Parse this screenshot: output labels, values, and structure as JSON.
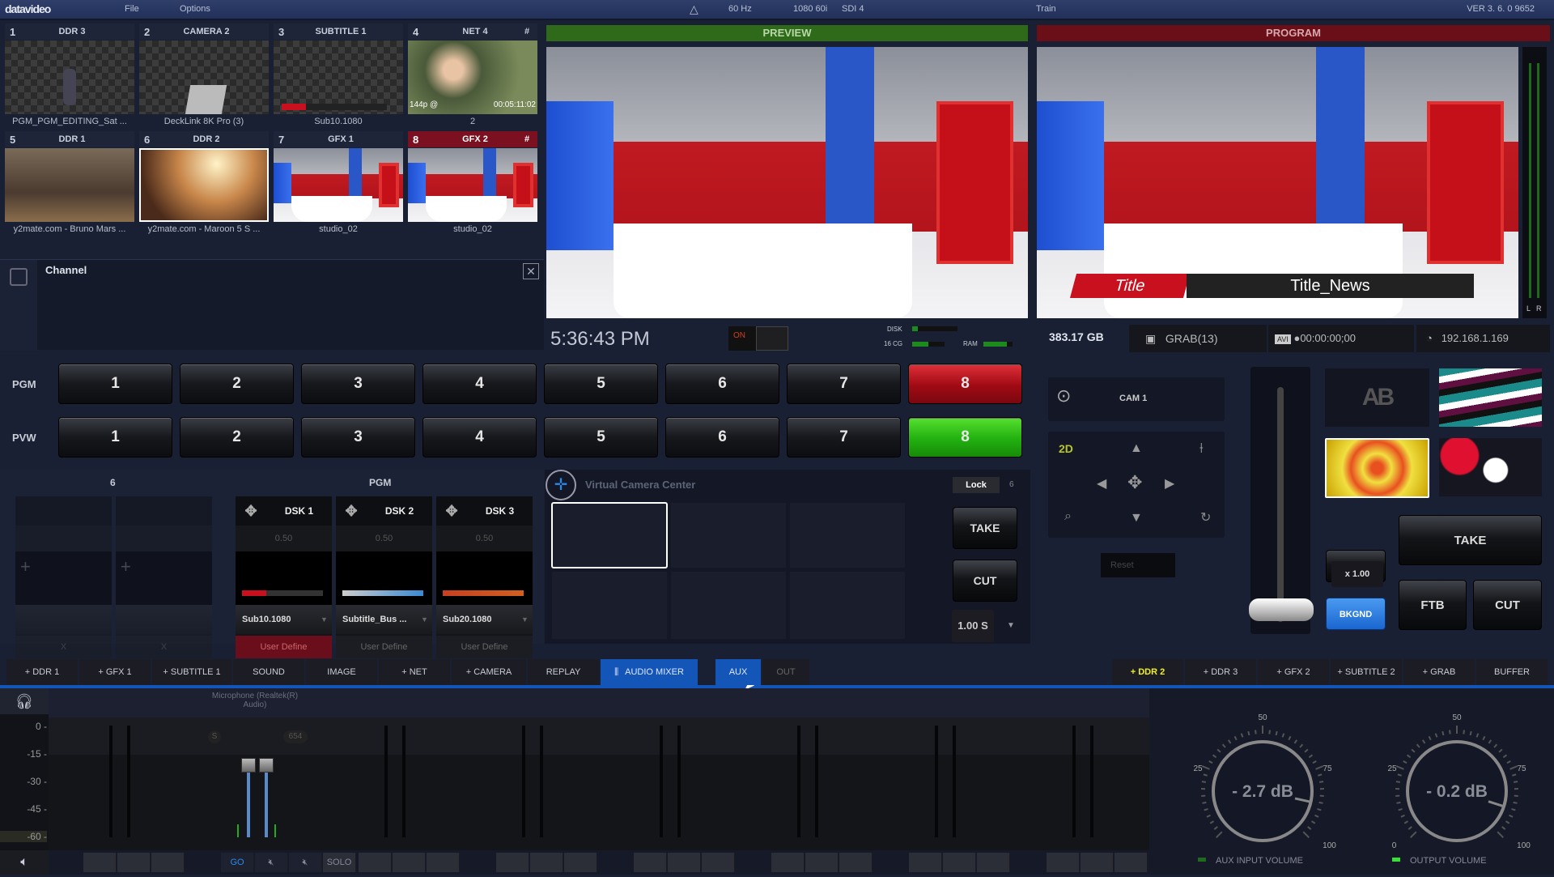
{
  "topbar": {
    "logo": "datavideo",
    "menu": [
      "File",
      "Options"
    ],
    "refresh_rate": "60 Hz",
    "format": "1080 60i",
    "output": "SDI 4",
    "user": "Train",
    "version": "VER 3. 6. 0 9652"
  },
  "sources": [
    {
      "num": "1",
      "name": "DDR 3",
      "label": "PGM_PGM_EDITING_Sat ...",
      "hash": "",
      "thumb": "checker-person"
    },
    {
      "num": "2",
      "name": "CAMERA 2",
      "label": "DeckLink 8K Pro (3)",
      "hash": "",
      "thumb": "checker-chair"
    },
    {
      "num": "3",
      "name": "SUBTITLE 1",
      "label": "Sub10.1080",
      "hash": "",
      "thumb": "checker-subtitle"
    },
    {
      "num": "4",
      "name": "NET 4",
      "label": "2",
      "hash": "#",
      "thumb": "face",
      "overlay_left": "144p @",
      "overlay_right": "00:05:11:02"
    },
    {
      "num": "5",
      "name": "DDR 1",
      "label": "y2mate.com - Bruno Mars ...",
      "hash": "",
      "thumb": "party"
    },
    {
      "num": "6",
      "name": "DDR 2",
      "label": "y2mate.com - Maroon 5  S ...",
      "hash": "",
      "thumb": "warm"
    },
    {
      "num": "7",
      "name": "GFX 1",
      "label": "studio_02",
      "hash": "",
      "thumb": "studio"
    },
    {
      "num": "8",
      "name": "GFX 2",
      "label": "studio_02",
      "hash": "#",
      "thumb": "studio",
      "active": true
    }
  ],
  "channel": {
    "title": "Channel"
  },
  "preview": {
    "label": "PREVIEW",
    "color": "#2f6a1a"
  },
  "program": {
    "label": "PROGRAM",
    "color": "#6a0e18",
    "lower_third_title": "Title",
    "lower_third_text": "Title_News",
    "meter_l": "L",
    "meter_r": "R"
  },
  "status": {
    "clock": "5:36:43 PM",
    "on_label": "ON",
    "disk_label": "DISK",
    "mem_label": "16 CG",
    "ram_label": "RAM",
    "free_space": "383.17 GB",
    "grab": "GRAB(13)",
    "rec_format": "AVI",
    "rec_time": "00:00:00;00",
    "ip": "192.168.1.169"
  },
  "bus": {
    "pgm_label": "PGM",
    "pvw_label": "PVW",
    "buttons": [
      "1",
      "2",
      "3",
      "4",
      "5",
      "6",
      "7",
      "8"
    ],
    "pgm_active": "8",
    "pvw_active": "8"
  },
  "keyers": {
    "group1_title": "6",
    "group2_title": "PGM",
    "blank_close": "X",
    "dsk": [
      {
        "name": "DSK 1",
        "value": "0.50",
        "source": "Sub10.1080",
        "mode": "User Define",
        "active": true
      },
      {
        "name": "DSK 2",
        "value": "0.50",
        "source": "Subtitle_Bus ...",
        "mode": "User Define",
        "active": false
      },
      {
        "name": "DSK 3",
        "value": "0.50",
        "source": "Sub20.1080",
        "mode": "User Define",
        "active": false
      }
    ]
  },
  "vcc": {
    "title": "Virtual Camera Center",
    "lock": "Lock",
    "lock_count": "6",
    "take": "TAKE",
    "cut": "CUT",
    "duration": "1.00 S"
  },
  "camera": {
    "name": "CAM 1",
    "mode": "2D",
    "reset": "Reset"
  },
  "transition": {
    "ab": "AB",
    "zoom": "ZOOM",
    "zoom_value": "x 1.00",
    "bkgnd": "BKGND",
    "take": "TAKE",
    "ftb": "FTB",
    "cut": "CUT",
    "tbar_position": 0
  },
  "tabs": {
    "left": [
      "+ DDR 1",
      "+ GFX 1",
      "+ SUBTITLE 1",
      "SOUND",
      "IMAGE",
      "+ NET",
      "+ CAMERA",
      "REPLAY",
      "AUDIO MIXER"
    ],
    "active": "AUDIO MIXER",
    "aux": "AUX",
    "out": "OUT",
    "right": [
      "+ DDR 2",
      "+ DDR 3",
      "+ GFX 2",
      "+ SUBTITLE 2",
      "+ GRAB",
      "BUFFER"
    ],
    "right_highlight": "+ DDR 2"
  },
  "audio": {
    "channel_name": "Microphone (Realtek(R) Audio)",
    "scale": [
      "0 -",
      "-15 -",
      "-30 -",
      "-45 -",
      "-60 -"
    ],
    "s_label": "S",
    "delay_value": "654",
    "go": "GO",
    "solo": "SOLO",
    "knobs": [
      {
        "value": "- 2.7 dB",
        "label": "AUX INPUT VOLUME",
        "ticks": [
          "",
          "25",
          "50",
          "75",
          "100"
        ],
        "level": 0.88,
        "led": "#1e6a1e"
      },
      {
        "value": "- 0.2 dB",
        "label": "OUTPUT VOLUME",
        "ticks": [
          "0",
          "25",
          "50",
          "75",
          "100"
        ],
        "level": 0.9,
        "led": "#38e038"
      }
    ]
  }
}
